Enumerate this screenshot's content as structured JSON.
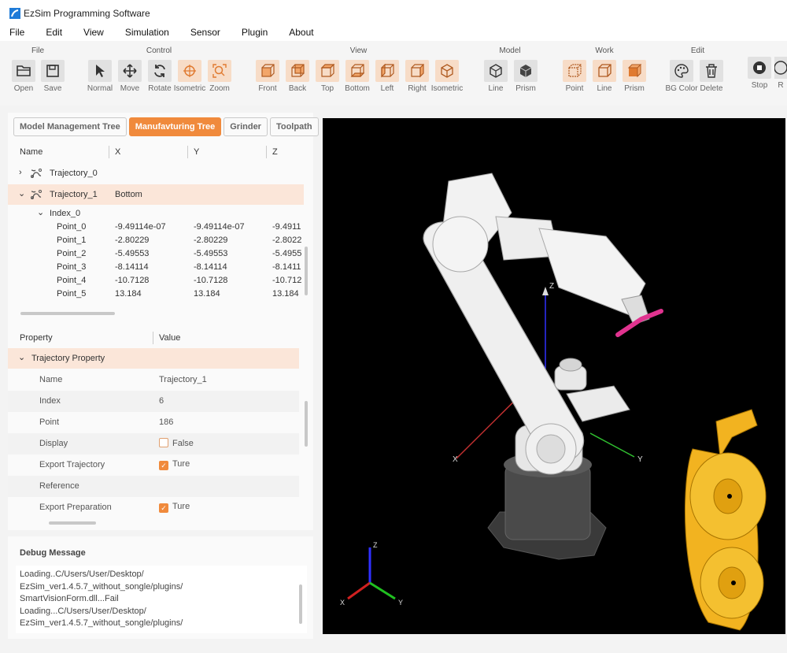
{
  "app": {
    "title": "EzSim Programming Software"
  },
  "menu": [
    "File",
    "Edit",
    "View",
    "Simulation",
    "Sensor",
    "Plugin",
    "About"
  ],
  "ribbon": {
    "groups": {
      "file": "File",
      "control": "Control",
      "view": "View",
      "model": "Model",
      "work": "Work",
      "edit": "Edit"
    },
    "buttons": {
      "open": "Open",
      "save": "Save",
      "normal": "Normal",
      "move": "Move",
      "rotate": "Rotate",
      "isometric": "Isometric",
      "zoom": "Zoom",
      "front": "Front",
      "back": "Back",
      "top": "Top",
      "bottom": "Bottom",
      "left": "Left",
      "right": "Right",
      "view_isometric": "Isometric",
      "line": "Line",
      "prism": "Prism",
      "point": "Point",
      "work_line": "Line",
      "work_prism": "Prism",
      "bg_color": "BG Color",
      "delete": "Delete",
      "stop": "Stop",
      "r": "R"
    }
  },
  "tabs": [
    "Model Management Tree",
    "Manufavturing Tree",
    "Grinder",
    "Toolpath"
  ],
  "tree": {
    "headers": {
      "name": "Name",
      "x": "X",
      "y": "Y",
      "z": "Z"
    },
    "trajectory0": "Trajectory_0",
    "trajectory1": {
      "name": "Trajectory_1",
      "x": "Bottom"
    },
    "index0": "Index_0",
    "points": [
      {
        "name": "Point_0",
        "x": "-9.49114e-07",
        "y": "-9.49114e-07",
        "z": "-9.4911"
      },
      {
        "name": "Point_1",
        "x": "-2.80229",
        "y": "-2.80229",
        "z": "-2.8022"
      },
      {
        "name": "Point_2",
        "x": "-5.49553",
        "y": "-5.49553",
        "z": "-5.4955"
      },
      {
        "name": "Point_3",
        "x": "-8.14114",
        "y": "-8.14114",
        "z": "-8.1411"
      },
      {
        "name": "Point_4",
        "x": "-10.7128",
        "y": "-10.7128",
        "z": "-10.712"
      },
      {
        "name": "Point_5",
        "x": "13.184",
        "y": "13.184",
        "z": "13.184"
      }
    ]
  },
  "properties": {
    "headers": {
      "property": "Property",
      "value": "Value"
    },
    "section": "Trajectory Property",
    "rows": [
      {
        "label": "Name",
        "value": "Trajectory_1"
      },
      {
        "label": "Index",
        "value": "6"
      },
      {
        "label": "Point",
        "value": "186"
      },
      {
        "label": "Display",
        "value": "False"
      },
      {
        "label": "Export Trajectory",
        "value": "Ture"
      },
      {
        "label": "Reference",
        "value": ""
      },
      {
        "label": "Export Preparation",
        "value": "Ture"
      }
    ]
  },
  "debug": {
    "title": "Debug Message",
    "lines": [
      "Loading..C/Users/User/Desktop/",
      "EzSim_ver1.4.5.7_without_songle/plugins/",
      "SmartVisionForm.dll...Fail",
      "Loading...C/Users/User/Desktop/",
      "EzSim_ver1.4.5.7_without_songle/plugins/"
    ]
  },
  "viewport": {
    "axis_labels": {
      "x": "X",
      "y": "Y",
      "z": "Z"
    },
    "colors": {
      "accent": "#f08a3c",
      "robot": "#eeeeee",
      "tool": "#e0338f",
      "gear": "#f2b320",
      "background": "#000000"
    }
  }
}
